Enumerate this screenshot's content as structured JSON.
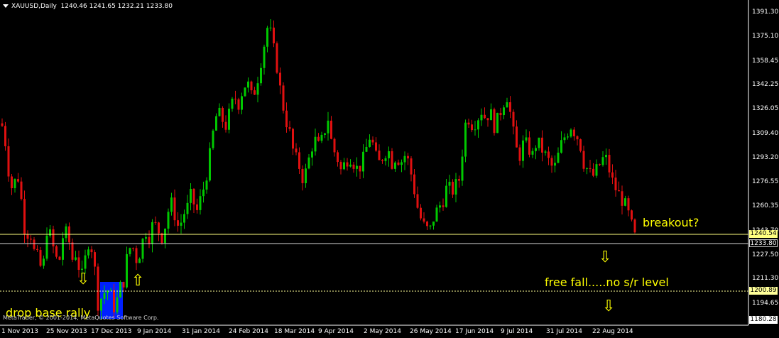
{
  "header": {
    "symbol_period": "XAUUSD,Daily",
    "ohlc": "1240.46 1241.65 1232.21 1233.80"
  },
  "colors": {
    "background": "#000000",
    "bull": "#00c800",
    "bear": "#e01010",
    "level_line": "#ffff80",
    "dotted_line": "#ffff99",
    "annotation": "#ffff00",
    "highlight_box": "#0020ff"
  },
  "annotations": {
    "breakout": "breakout?",
    "free_fall": "free fall.....no s/r level",
    "drop_base_rally": "drop base rally"
  },
  "copyright": "MetaTrader, © 2001-2014, MetaQuotes Software Corp.",
  "price_boxes": {
    "level": "1240.54",
    "current": "1233.80",
    "dotted_level": "1200.89",
    "bottom": "1180.28"
  },
  "chart_data": {
    "type": "candlestick",
    "symbol": "XAUUSD",
    "timeframe": "Daily",
    "ylim": [
      1180.28,
      1400.0
    ],
    "y_ticks": [
      1391.3,
      1375.1,
      1358.45,
      1342.25,
      1326.05,
      1309.4,
      1293.2,
      1276.55,
      1260.35,
      1243.7,
      1227.5,
      1211.3,
      1194.65
    ],
    "y_tick_labels": [
      "1391.30",
      "1375.10",
      "1358.45",
      "1342.25",
      "1326.05",
      "1309.40",
      "1293.20",
      "1276.55",
      "1260.35",
      "1243.70",
      "1227.50",
      "1211.30",
      "1194.65"
    ],
    "x_tick_labels": [
      "1 Nov 2013",
      "25 Nov 2013",
      "17 Dec 2013",
      "9 Jan 2014",
      "31 Jan 2014",
      "24 Feb 2014",
      "18 Mar 2014",
      "9 Apr 2014",
      "2 May 2014",
      "26 May 2014",
      "17 Jun 2014",
      "9 Jul 2014",
      "31 Jul 2014",
      "22 Aug 2014"
    ],
    "horizontal_levels": [
      {
        "value": 1240.54,
        "style": "solid"
      },
      {
        "value": 1233.8,
        "style": "solid"
      },
      {
        "value": 1200.89,
        "style": "dotted"
      }
    ],
    "close_path": [
      [
        0,
        1320
      ],
      [
        6,
        1310
      ],
      [
        12,
        1285
      ],
      [
        18,
        1270
      ],
      [
        24,
        1285
      ],
      [
        30,
        1265
      ],
      [
        36,
        1240
      ],
      [
        42,
        1245
      ],
      [
        48,
        1230
      ],
      [
        54,
        1225
      ],
      [
        60,
        1215
      ],
      [
        66,
        1245
      ],
      [
        72,
        1240
      ],
      [
        78,
        1225
      ],
      [
        84,
        1225
      ],
      [
        90,
        1245
      ],
      [
        96,
        1240
      ],
      [
        102,
        1225
      ],
      [
        108,
        1230
      ],
      [
        114,
        1210
      ],
      [
        120,
        1225
      ],
      [
        126,
        1240
      ],
      [
        132,
        1225
      ],
      [
        138,
        1195
      ],
      [
        144,
        1200
      ],
      [
        150,
        1205
      ],
      [
        156,
        1200
      ],
      [
        162,
        1190
      ],
      [
        168,
        1205
      ],
      [
        174,
        1210
      ],
      [
        180,
        1230
      ],
      [
        186,
        1235
      ],
      [
        192,
        1225
      ],
      [
        198,
        1230
      ],
      [
        204,
        1245
      ],
      [
        210,
        1240
      ],
      [
        216,
        1250
      ],
      [
        222,
        1245
      ],
      [
        228,
        1240
      ],
      [
        234,
        1250
      ],
      [
        240,
        1265
      ],
      [
        246,
        1255
      ],
      [
        252,
        1245
      ],
      [
        258,
        1255
      ],
      [
        264,
        1260
      ],
      [
        270,
        1270
      ],
      [
        276,
        1255
      ],
      [
        282,
        1265
      ],
      [
        288,
        1275
      ],
      [
        294,
        1290
      ],
      [
        300,
        1310
      ],
      [
        306,
        1325
      ],
      [
        312,
        1320
      ],
      [
        318,
        1315
      ],
      [
        324,
        1325
      ],
      [
        330,
        1335
      ],
      [
        336,
        1330
      ],
      [
        342,
        1340
      ],
      [
        348,
        1345
      ],
      [
        354,
        1335
      ],
      [
        360,
        1340
      ],
      [
        366,
        1355
      ],
      [
        372,
        1370
      ],
      [
        378,
        1385
      ],
      [
        384,
        1370
      ],
      [
        390,
        1355
      ],
      [
        396,
        1335
      ],
      [
        402,
        1320
      ],
      [
        408,
        1310
      ],
      [
        414,
        1295
      ],
      [
        420,
        1290
      ],
      [
        426,
        1280
      ],
      [
        432,
        1285
      ],
      [
        438,
        1300
      ],
      [
        444,
        1305
      ],
      [
        450,
        1300
      ],
      [
        456,
        1310
      ],
      [
        462,
        1320
      ],
      [
        468,
        1300
      ],
      [
        474,
        1295
      ],
      [
        480,
        1285
      ],
      [
        486,
        1290
      ],
      [
        492,
        1295
      ],
      [
        498,
        1290
      ],
      [
        504,
        1285
      ],
      [
        510,
        1290
      ],
      [
        516,
        1300
      ],
      [
        522,
        1310
      ],
      [
        528,
        1295
      ],
      [
        534,
        1290
      ],
      [
        540,
        1295
      ],
      [
        546,
        1300
      ],
      [
        552,
        1290
      ],
      [
        558,
        1295
      ],
      [
        564,
        1290
      ],
      [
        570,
        1295
      ],
      [
        576,
        1290
      ],
      [
        582,
        1275
      ],
      [
        588,
        1260
      ],
      [
        594,
        1250
      ],
      [
        600,
        1245
      ],
      [
        606,
        1245
      ],
      [
        612,
        1255
      ],
      [
        618,
        1260
      ],
      [
        624,
        1265
      ],
      [
        630,
        1275
      ],
      [
        636,
        1270
      ],
      [
        642,
        1275
      ],
      [
        648,
        1280
      ],
      [
        654,
        1315
      ],
      [
        660,
        1320
      ],
      [
        666,
        1315
      ],
      [
        672,
        1320
      ],
      [
        678,
        1325
      ],
      [
        684,
        1320
      ],
      [
        690,
        1325
      ],
      [
        696,
        1315
      ],
      [
        702,
        1320
      ],
      [
        708,
        1330
      ],
      [
        714,
        1335
      ],
      [
        720,
        1320
      ],
      [
        726,
        1300
      ],
      [
        732,
        1295
      ],
      [
        738,
        1305
      ],
      [
        744,
        1300
      ],
      [
        750,
        1295
      ],
      [
        756,
        1305
      ],
      [
        762,
        1300
      ],
      [
        768,
        1295
      ],
      [
        774,
        1290
      ],
      [
        780,
        1285
      ],
      [
        786,
        1295
      ],
      [
        792,
        1305
      ],
      [
        798,
        1310
      ],
      [
        804,
        1315
      ],
      [
        810,
        1310
      ],
      [
        816,
        1305
      ],
      [
        822,
        1290
      ],
      [
        828,
        1285
      ],
      [
        834,
        1280
      ],
      [
        840,
        1285
      ],
      [
        846,
        1290
      ],
      [
        852,
        1295
      ],
      [
        858,
        1285
      ],
      [
        864,
        1275
      ],
      [
        870,
        1270
      ],
      [
        876,
        1265
      ],
      [
        882,
        1260
      ],
      [
        888,
        1250
      ],
      [
        894,
        1240
      ],
      [
        896,
        1233.8
      ]
    ]
  }
}
